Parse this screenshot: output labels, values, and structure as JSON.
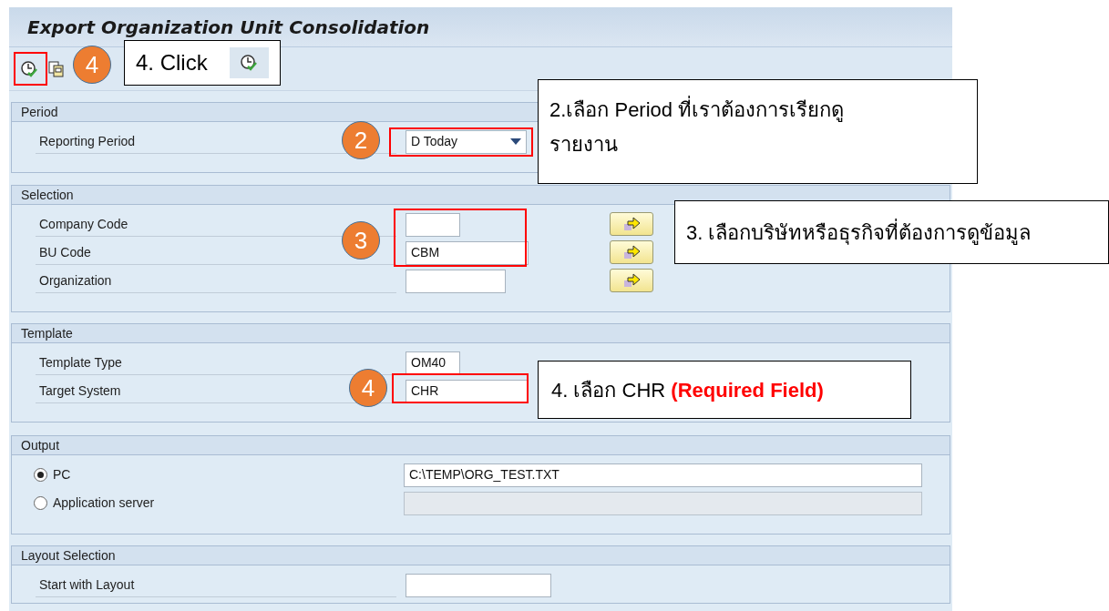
{
  "window": {
    "title": "Export Organization Unit Consolidation"
  },
  "groups": [
    {
      "title": "Period",
      "fields": [
        {
          "kind": "dropdown",
          "label": "Reporting Period",
          "value": "D Today"
        }
      ]
    },
    {
      "title": "Selection",
      "fields": [
        {
          "kind": "text",
          "label": "Company Code",
          "multiple_selection": true
        },
        {
          "kind": "text",
          "label": "BU Code",
          "value": "CBM",
          "multiple_selection": true
        },
        {
          "kind": "text",
          "label": "Organization",
          "multiple_selection": true
        }
      ]
    },
    {
      "title": "Template",
      "fields": [
        {
          "kind": "text",
          "label": "Template Type",
          "value": "OM40"
        },
        {
          "kind": "text",
          "label": "Target System",
          "value": "CHR"
        }
      ]
    },
    {
      "title": "Output",
      "fields": [
        {
          "kind": "radio",
          "label": "PC",
          "selected": true,
          "value": "C:\\TEMP\\ORG_TEST.TXT",
          "disabled": false
        },
        {
          "kind": "radio",
          "label": "Application server",
          "selected": false,
          "disabled": true
        }
      ]
    },
    {
      "title": "Layout Selection",
      "fields": [
        {
          "kind": "text",
          "label": "Start with Layout"
        }
      ]
    }
  ],
  "annotations": [
    {
      "kind": "badge",
      "text": "4"
    },
    {
      "kind": "callout",
      "text": "4. Click",
      "icon": true
    },
    {
      "kind": "badge",
      "text": "2"
    },
    {
      "kind": "callout",
      "text": "2.เลือก Period ที่เราต้องการเรียกดู\nรายงาน"
    },
    {
      "kind": "badge",
      "text": "3"
    },
    {
      "kind": "callout",
      "text": "3. เลือกบริษัทหรือธุรกิจที่ต้องการดูข้อมูล"
    },
    {
      "kind": "badge",
      "text": "4"
    },
    {
      "kind": "callout",
      "text": "4. เลือก CHR **(Required Field)**"
    }
  ]
}
